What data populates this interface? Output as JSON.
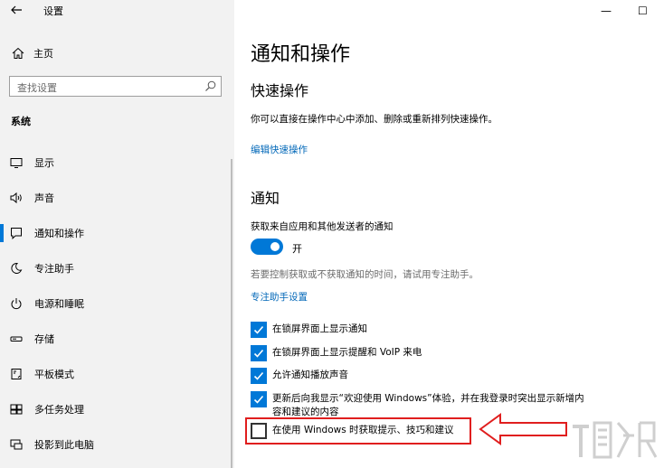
{
  "window": {
    "title": "设置",
    "minimize_glyph": "—",
    "maximize_glyph": "☐"
  },
  "sidebar": {
    "home_label": "主页",
    "search_placeholder": "查找设置",
    "section_label": "系统",
    "items": [
      {
        "label": "显示",
        "icon": "display-icon",
        "active": false
      },
      {
        "label": "声音",
        "icon": "sound-icon",
        "active": false
      },
      {
        "label": "通知和操作",
        "icon": "notification-icon",
        "active": true
      },
      {
        "label": "专注助手",
        "icon": "moon-icon",
        "active": false
      },
      {
        "label": "电源和睡眠",
        "icon": "power-icon",
        "active": false
      },
      {
        "label": "存储",
        "icon": "storage-icon",
        "active": false
      },
      {
        "label": "平板模式",
        "icon": "tablet-icon",
        "active": false
      },
      {
        "label": "多任务处理",
        "icon": "multitask-icon",
        "active": false
      },
      {
        "label": "投影到此电脑",
        "icon": "project-icon",
        "active": false
      }
    ]
  },
  "main": {
    "page_title": "通知和操作",
    "quick_actions": {
      "heading": "快速操作",
      "description": "你可以直接在操作中心中添加、删除或重新排列快速操作。",
      "link": "编辑快速操作"
    },
    "notifications": {
      "heading": "通知",
      "setting_label": "获取来自应用和其他发送者的通知",
      "toggle_state": "开",
      "toggle_on": true,
      "focus_hint": "若要控制获取或不获取通知的时间，请试用专注助手。",
      "focus_link": "专注助手设置",
      "checkboxes": [
        {
          "label": "在锁屏界面上显示通知",
          "checked": true
        },
        {
          "label": "在锁屏界面上显示提醒和 VoIP 来电",
          "checked": true
        },
        {
          "label": "允许通知播放声音",
          "checked": true
        },
        {
          "label": "更新后向我显示“欢迎使用 Windows”体验，并在我登录时突出显示新增内容和建议的内容",
          "checked": true
        },
        {
          "label": "在使用 Windows 时获取提示、技巧和建议",
          "checked": false
        }
      ]
    }
  },
  "annotation": {
    "highlight_color": "#e01e1e"
  },
  "colors": {
    "accent": "#0078d7",
    "link": "#0067b8",
    "sidebar_bg": "#f2f2f2"
  }
}
